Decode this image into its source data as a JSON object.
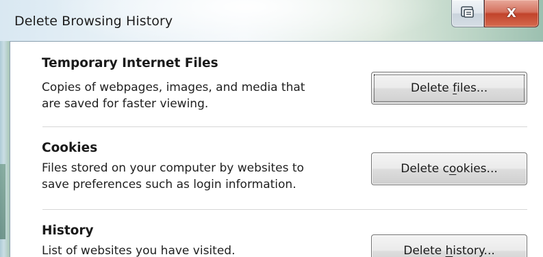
{
  "window": {
    "title": "Delete Browsing History",
    "restore_icon": "restore-icon",
    "close_glyph": "X"
  },
  "sections": [
    {
      "title": "Temporary Internet Files",
      "description_lines": [
        "Copies of webpages, images, and media that",
        "are saved for faster viewing."
      ],
      "button": {
        "before": "Delete ",
        "mnemonic": "f",
        "after": "iles..."
      }
    },
    {
      "title": "Cookies",
      "description_lines": [
        "Files stored on your computer by websites to",
        "save preferences such as login information."
      ],
      "button": {
        "before": "Delete c",
        "mnemonic": "o",
        "after": "okies..."
      }
    },
    {
      "title": "History",
      "description_lines": [
        "List of websites you have visited."
      ],
      "button": {
        "before": "Delete ",
        "mnemonic": "h",
        "after": "istory..."
      }
    }
  ],
  "colors": {
    "close_button": "#c2432b",
    "title_text": "#1e1e1e",
    "divider": "#d6d6d6"
  }
}
